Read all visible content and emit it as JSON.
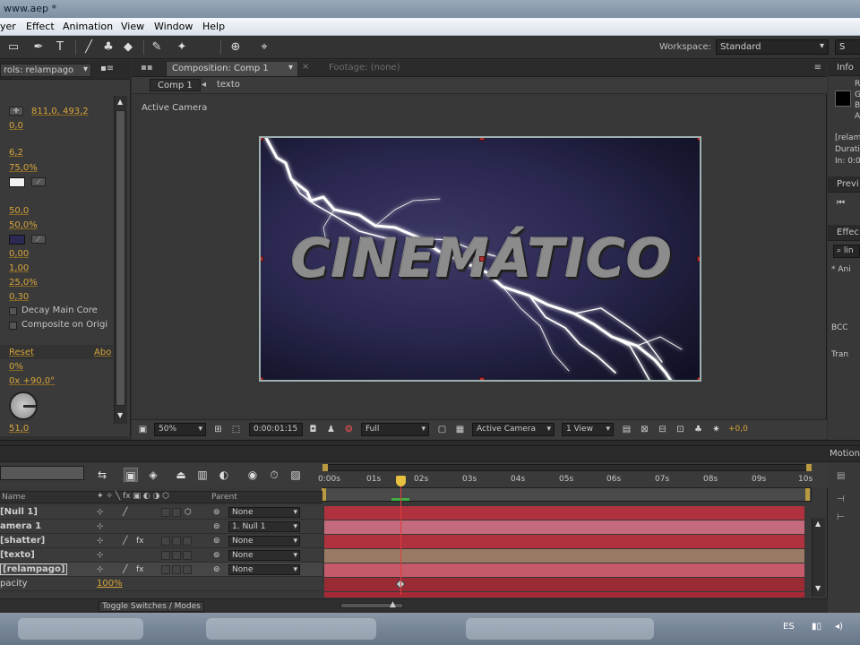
{
  "window": {
    "title": "www.aep *"
  },
  "menu": [
    "yer",
    "Effect",
    "Animation",
    "View",
    "Window",
    "Help"
  ],
  "toolbar": {
    "workspace_label": "Workspace:",
    "workspace_value": "Standard",
    "search_placeholder": "S"
  },
  "effect_controls": {
    "tab_label": "rols: relampago",
    "values": [
      "811,0, 493,2",
      "0,0",
      "6,2",
      "75,0%",
      "50,0",
      "50,0%",
      "0,00",
      "1,00",
      "25,0%",
      "0,30"
    ],
    "checkbox_decay": "Decay Main Core",
    "checkbox_composite": "Composite on Origi",
    "reset": "Reset",
    "about": "Abo",
    "percent": "0%",
    "rotation": "0x +90,0°",
    "bottom_value": "51,0",
    "color_main": "#f2f2f2",
    "color_glow": "#2c2a55"
  },
  "composition": {
    "tab_label": "Composition: Comp 1",
    "footage_tab": "Footage: (none)",
    "breadcrumb_comp": "Comp 1",
    "breadcrumb_layer": "texto",
    "view_label": "Active Camera",
    "title_text": "CINEMÁTICO",
    "zoom": "50%",
    "timecode": "0:00:01:15",
    "resolution": "Full",
    "camera": "Active Camera",
    "views": "1 View",
    "exposure": "+0,0"
  },
  "right_panels": {
    "info_tab": "Info",
    "info_lines": [
      "R",
      "G",
      "B",
      "A"
    ],
    "info_layer": "[relam",
    "info_duration": "Durati",
    "info_in": "In: 0:0",
    "preview_tab": "Previ",
    "effects_tab": "Effec",
    "effects_search": "lin",
    "effects_items": [
      "* Ani",
      "BCC",
      "Tran"
    ],
    "motion_tab": "Motion"
  },
  "timeline": {
    "col_name": "Name",
    "col_parent": "Parent",
    "ruler_labels": [
      "0:00s",
      "01s",
      "02s",
      "03s",
      "04s",
      "05s",
      "06s",
      "07s",
      "08s",
      "09s",
      "10s"
    ],
    "layers": [
      {
        "name": "[Null 1]",
        "parent": "None",
        "bar_color": "#b0323e"
      },
      {
        "name": "amera 1",
        "parent": "1. Null 1",
        "bar_color": "#c46a7c"
      },
      {
        "name": "[shatter]",
        "parent": "None",
        "bar_color": "#b0323e"
      },
      {
        "name": "[texto]",
        "parent": "None",
        "bar_color": "#9a7a64"
      },
      {
        "name": "[relampago]",
        "parent": "None",
        "bar_color": "#c45a6a"
      }
    ],
    "sub_property": "pacity",
    "sub_value": "100%",
    "toggle_label": "Toggle Switches / Modes"
  },
  "taskbar": {
    "language": "ES"
  }
}
